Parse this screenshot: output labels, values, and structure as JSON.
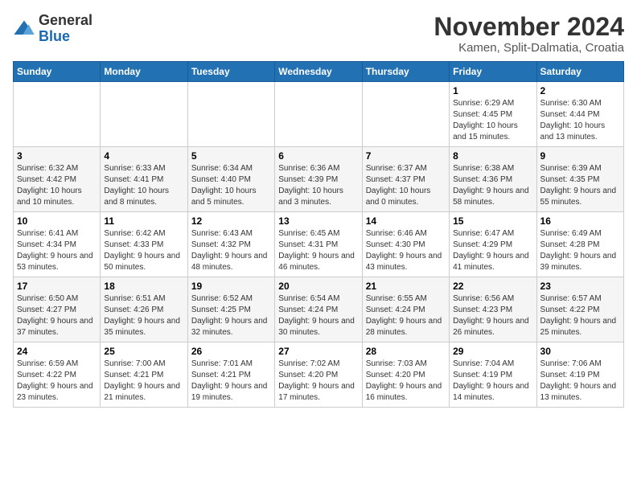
{
  "header": {
    "logo_general": "General",
    "logo_blue": "Blue",
    "month_title": "November 2024",
    "subtitle": "Kamen, Split-Dalmatia, Croatia"
  },
  "weekdays": [
    "Sunday",
    "Monday",
    "Tuesday",
    "Wednesday",
    "Thursday",
    "Friday",
    "Saturday"
  ],
  "weeks": [
    [
      {
        "day": "",
        "info": ""
      },
      {
        "day": "",
        "info": ""
      },
      {
        "day": "",
        "info": ""
      },
      {
        "day": "",
        "info": ""
      },
      {
        "day": "",
        "info": ""
      },
      {
        "day": "1",
        "info": "Sunrise: 6:29 AM\nSunset: 4:45 PM\nDaylight: 10 hours and 15 minutes."
      },
      {
        "day": "2",
        "info": "Sunrise: 6:30 AM\nSunset: 4:44 PM\nDaylight: 10 hours and 13 minutes."
      }
    ],
    [
      {
        "day": "3",
        "info": "Sunrise: 6:32 AM\nSunset: 4:42 PM\nDaylight: 10 hours and 10 minutes."
      },
      {
        "day": "4",
        "info": "Sunrise: 6:33 AM\nSunset: 4:41 PM\nDaylight: 10 hours and 8 minutes."
      },
      {
        "day": "5",
        "info": "Sunrise: 6:34 AM\nSunset: 4:40 PM\nDaylight: 10 hours and 5 minutes."
      },
      {
        "day": "6",
        "info": "Sunrise: 6:36 AM\nSunset: 4:39 PM\nDaylight: 10 hours and 3 minutes."
      },
      {
        "day": "7",
        "info": "Sunrise: 6:37 AM\nSunset: 4:37 PM\nDaylight: 10 hours and 0 minutes."
      },
      {
        "day": "8",
        "info": "Sunrise: 6:38 AM\nSunset: 4:36 PM\nDaylight: 9 hours and 58 minutes."
      },
      {
        "day": "9",
        "info": "Sunrise: 6:39 AM\nSunset: 4:35 PM\nDaylight: 9 hours and 55 minutes."
      }
    ],
    [
      {
        "day": "10",
        "info": "Sunrise: 6:41 AM\nSunset: 4:34 PM\nDaylight: 9 hours and 53 minutes."
      },
      {
        "day": "11",
        "info": "Sunrise: 6:42 AM\nSunset: 4:33 PM\nDaylight: 9 hours and 50 minutes."
      },
      {
        "day": "12",
        "info": "Sunrise: 6:43 AM\nSunset: 4:32 PM\nDaylight: 9 hours and 48 minutes."
      },
      {
        "day": "13",
        "info": "Sunrise: 6:45 AM\nSunset: 4:31 PM\nDaylight: 9 hours and 46 minutes."
      },
      {
        "day": "14",
        "info": "Sunrise: 6:46 AM\nSunset: 4:30 PM\nDaylight: 9 hours and 43 minutes."
      },
      {
        "day": "15",
        "info": "Sunrise: 6:47 AM\nSunset: 4:29 PM\nDaylight: 9 hours and 41 minutes."
      },
      {
        "day": "16",
        "info": "Sunrise: 6:49 AM\nSunset: 4:28 PM\nDaylight: 9 hours and 39 minutes."
      }
    ],
    [
      {
        "day": "17",
        "info": "Sunrise: 6:50 AM\nSunset: 4:27 PM\nDaylight: 9 hours and 37 minutes."
      },
      {
        "day": "18",
        "info": "Sunrise: 6:51 AM\nSunset: 4:26 PM\nDaylight: 9 hours and 35 minutes."
      },
      {
        "day": "19",
        "info": "Sunrise: 6:52 AM\nSunset: 4:25 PM\nDaylight: 9 hours and 32 minutes."
      },
      {
        "day": "20",
        "info": "Sunrise: 6:54 AM\nSunset: 4:24 PM\nDaylight: 9 hours and 30 minutes."
      },
      {
        "day": "21",
        "info": "Sunrise: 6:55 AM\nSunset: 4:24 PM\nDaylight: 9 hours and 28 minutes."
      },
      {
        "day": "22",
        "info": "Sunrise: 6:56 AM\nSunset: 4:23 PM\nDaylight: 9 hours and 26 minutes."
      },
      {
        "day": "23",
        "info": "Sunrise: 6:57 AM\nSunset: 4:22 PM\nDaylight: 9 hours and 25 minutes."
      }
    ],
    [
      {
        "day": "24",
        "info": "Sunrise: 6:59 AM\nSunset: 4:22 PM\nDaylight: 9 hours and 23 minutes."
      },
      {
        "day": "25",
        "info": "Sunrise: 7:00 AM\nSunset: 4:21 PM\nDaylight: 9 hours and 21 minutes."
      },
      {
        "day": "26",
        "info": "Sunrise: 7:01 AM\nSunset: 4:21 PM\nDaylight: 9 hours and 19 minutes."
      },
      {
        "day": "27",
        "info": "Sunrise: 7:02 AM\nSunset: 4:20 PM\nDaylight: 9 hours and 17 minutes."
      },
      {
        "day": "28",
        "info": "Sunrise: 7:03 AM\nSunset: 4:20 PM\nDaylight: 9 hours and 16 minutes."
      },
      {
        "day": "29",
        "info": "Sunrise: 7:04 AM\nSunset: 4:19 PM\nDaylight: 9 hours and 14 minutes."
      },
      {
        "day": "30",
        "info": "Sunrise: 7:06 AM\nSunset: 4:19 PM\nDaylight: 9 hours and 13 minutes."
      }
    ]
  ]
}
